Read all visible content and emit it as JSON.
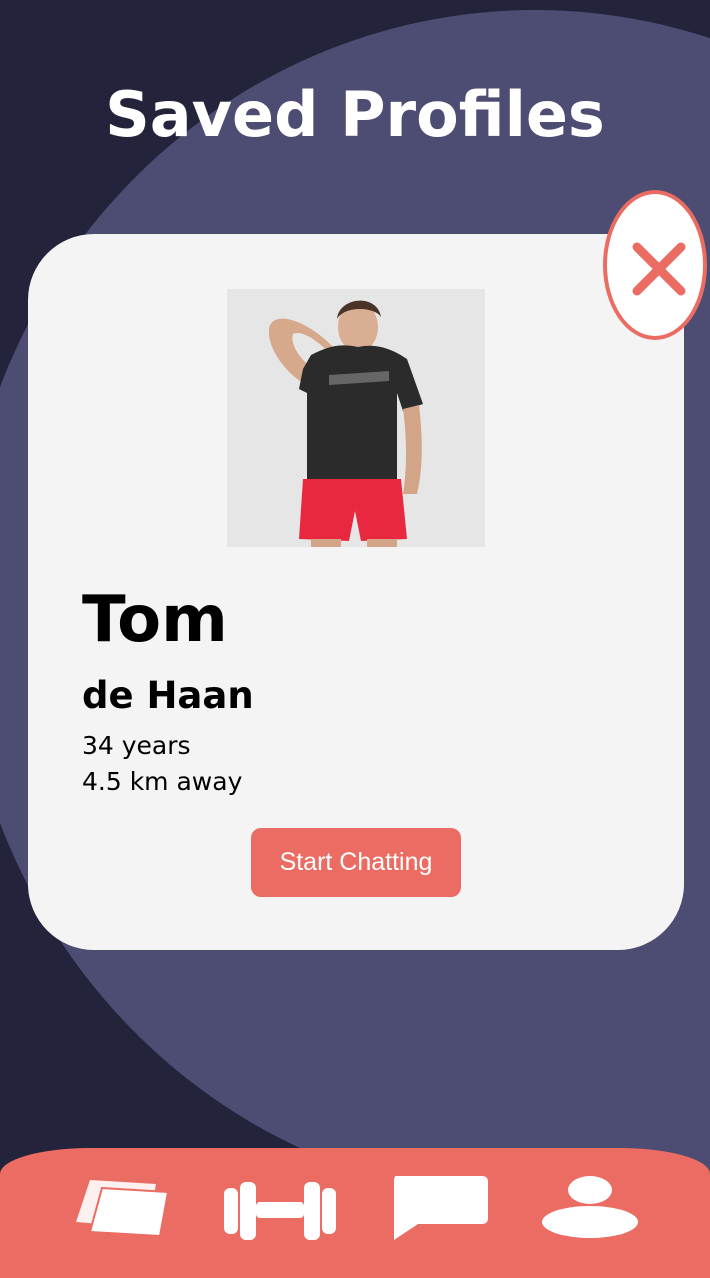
{
  "header": {
    "title": "Saved Profiles"
  },
  "profile": {
    "first_name": "Tom",
    "last_name": "de Haan",
    "age": "34 years",
    "distance": "4.5 km away",
    "photo_icon": "profile-photo",
    "action_label": "Start Chatting"
  },
  "close": {
    "icon": "close-icon"
  },
  "nav": {
    "items": [
      {
        "name": "cards",
        "icon": "cards-icon"
      },
      {
        "name": "workout",
        "icon": "dumbbell-icon"
      },
      {
        "name": "chat",
        "icon": "chat-bubble-icon"
      },
      {
        "name": "profile",
        "icon": "person-icon"
      }
    ]
  },
  "colors": {
    "background": "#23233b",
    "blob": "#4d4c72",
    "card": "#f4f4f4",
    "accent": "#ea6c62",
    "text": "#000000",
    "title": "#ffffff"
  }
}
